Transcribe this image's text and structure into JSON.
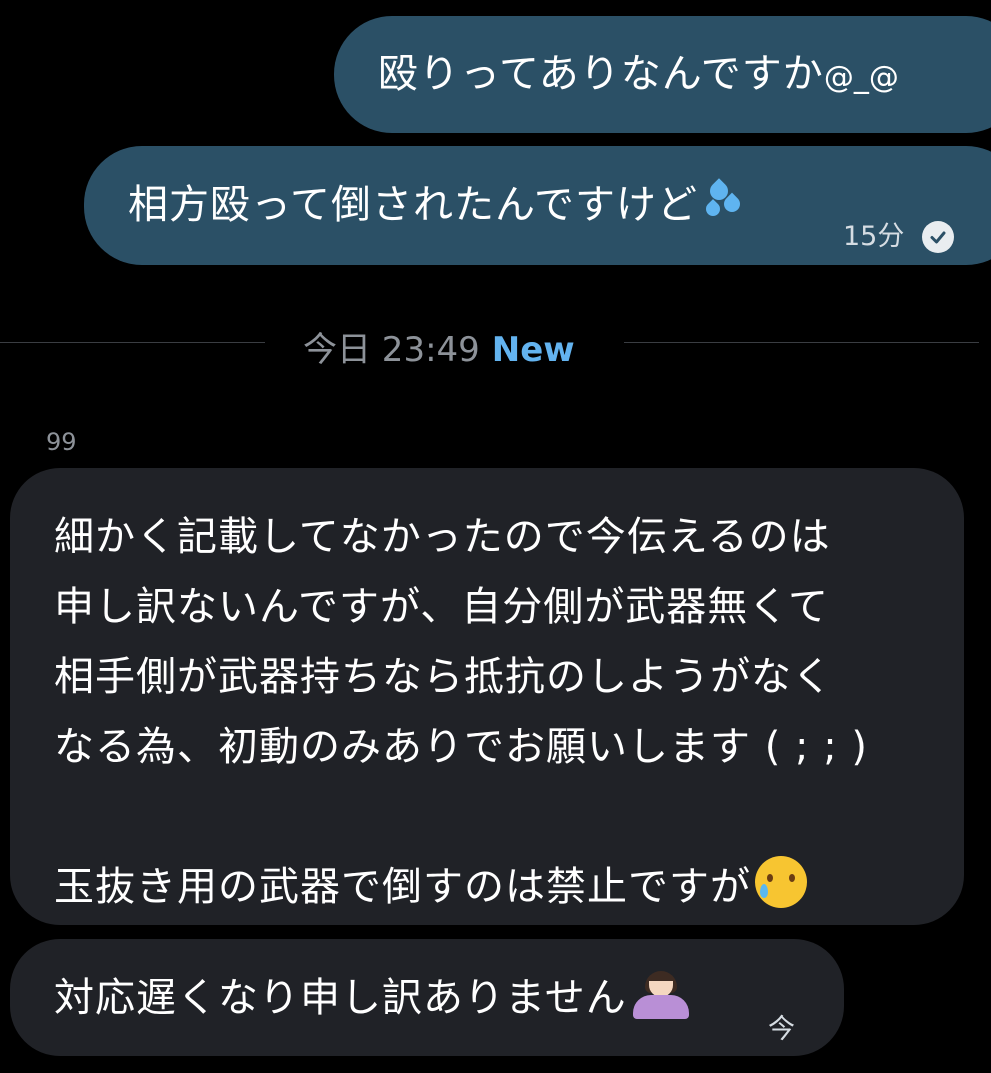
{
  "outgoing": [
    {
      "text": "殴りってありなんですか",
      "emoji": "@_@"
    },
    {
      "text": "相方殴って倒されたんですけど",
      "emoji_name": "sweat-droplets",
      "time": "15分",
      "status_icon": "read-check-icon"
    }
  ],
  "divider": {
    "label": "今日 23:49",
    "badge": "New",
    "badge_color": "#63b3ef"
  },
  "sender": {
    "name": "99"
  },
  "incoming": [
    {
      "text": "細かく記載してなかったので今伝えるのは\n申し訳ないんですが、自分側が武器無くて\n相手側が武器持ちなら抵抗のしようがなく\nなる為、初動のみありでお願いします ( ; ; )\n\n玉抜き用の武器で倒すのは禁止ですが",
      "emoji_name": "face-holding-back-tears"
    },
    {
      "text": "対応遅くなり申し訳ありません",
      "emoji_name": "person-bowing",
      "time": "今"
    }
  ],
  "colors": {
    "background": "#000000",
    "outgoing_bubble": "#2b5066",
    "incoming_bubble": "#202227",
    "meta_text": "#8d9299"
  }
}
